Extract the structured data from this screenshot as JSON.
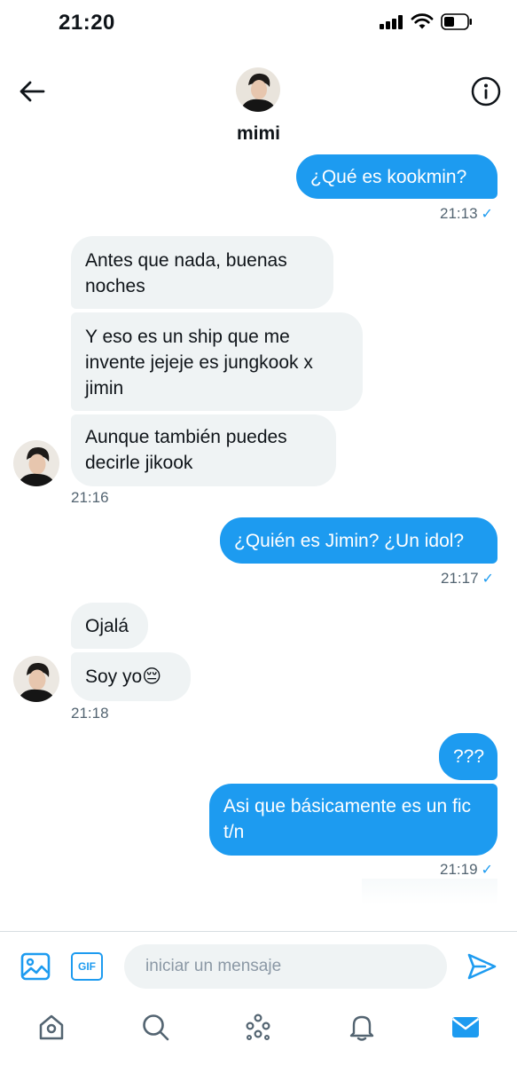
{
  "status_bar": {
    "time": "21:20",
    "icons": [
      "signal-icon",
      "wifi-icon",
      "battery-icon"
    ]
  },
  "header": {
    "contact_name": "mimi",
    "back_icon": "arrow-left-icon",
    "info_icon": "info-icon"
  },
  "colors": {
    "accent": "#1d9bf0",
    "incoming_bubble": "#eff3f4",
    "meta_text": "#536471"
  },
  "messages": [
    {
      "direction": "outgoing",
      "text": "¿Qué es kookmin?"
    },
    {
      "direction": "outgoing_meta",
      "time": "21:13",
      "status_icon": "check-icon"
    },
    {
      "direction": "incoming",
      "text": "Antes que nada, buenas noches"
    },
    {
      "direction": "incoming",
      "text": "Y eso es un ship que me invente jejeje es jungkook x jimin"
    },
    {
      "direction": "incoming",
      "text": "Aunque también puedes decirle jikook"
    },
    {
      "direction": "incoming_meta",
      "time": "21:16"
    },
    {
      "direction": "outgoing",
      "text": "¿Quién es Jimin? ¿Un idol?"
    },
    {
      "direction": "outgoing_meta",
      "time": "21:17",
      "status_icon": "check-icon"
    },
    {
      "direction": "incoming",
      "text": "Ojalá"
    },
    {
      "direction": "incoming",
      "text": "Soy yo😔"
    },
    {
      "direction": "incoming_meta",
      "time": "21:18"
    },
    {
      "direction": "outgoing",
      "text": "???"
    },
    {
      "direction": "outgoing",
      "text": "Asi que básicamente es un fic t/n"
    },
    {
      "direction": "outgoing_meta",
      "time": "21:19",
      "status_icon": "check-icon"
    }
  ],
  "composer": {
    "placeholder": "iniciar un mensaje",
    "gif_label": "GIF",
    "image_icon": "image-icon",
    "send_icon": "send-icon"
  },
  "tab_bar": [
    {
      "icon": "home-icon",
      "active": false
    },
    {
      "icon": "search-icon",
      "active": false
    },
    {
      "icon": "spaces-icon",
      "active": false
    },
    {
      "icon": "bell-icon",
      "active": false
    },
    {
      "icon": "mail-icon",
      "active": true
    }
  ]
}
